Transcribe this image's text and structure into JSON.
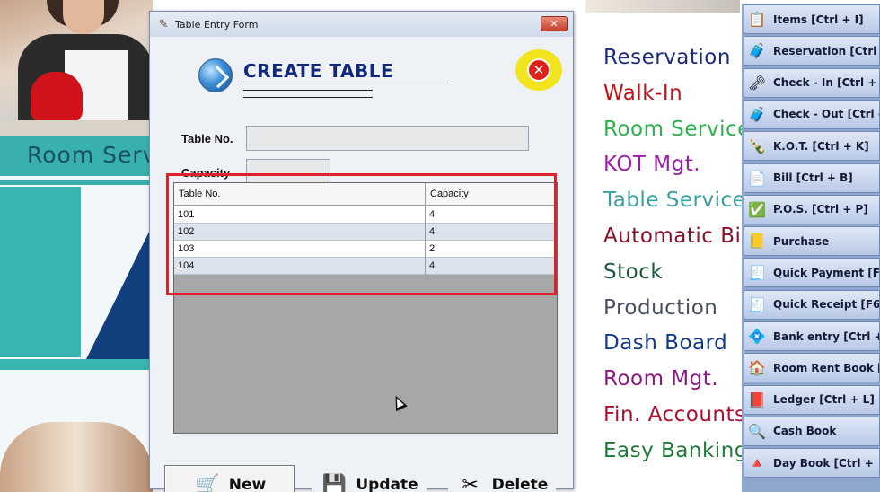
{
  "background": {
    "banner_text": "Room Serv",
    "menu": [
      {
        "label": "Reservation",
        "color": "#1b2a7a"
      },
      {
        "label": "Walk-In",
        "color": "#c0131b"
      },
      {
        "label": "Room Service",
        "color": "#2bb24c"
      },
      {
        "label": "KOT Mgt.",
        "color": "#9b1fa6"
      },
      {
        "label": "Table Service",
        "color": "#3aa1a0"
      },
      {
        "label": "Automatic Bil",
        "color": "#8a0f2a"
      },
      {
        "label": "Stock",
        "color": "#1d5a3a"
      },
      {
        "label": "Production",
        "color": "#4b4f63"
      },
      {
        "label": "Dash Board",
        "color": "#133b8c"
      },
      {
        "label": "Room Mgt.",
        "color": "#8b1a7e"
      },
      {
        "label": "Fin. Accounts",
        "color": "#b0102f"
      },
      {
        "label": "Easy Banking",
        "color": "#1f7a3a"
      }
    ]
  },
  "sidebar": {
    "buttons": [
      {
        "label": "Items [Ctrl + I]",
        "icon": "items-icon",
        "glyph": "📋"
      },
      {
        "label": "Reservation [Ctrl",
        "icon": "reservation-icon",
        "glyph": "🧳"
      },
      {
        "label": "Check - In [Ctrl +",
        "icon": "check-in-icon",
        "glyph": "🗝"
      },
      {
        "label": "Check - Out [Ctrl -",
        "icon": "check-out-icon",
        "glyph": "🧳"
      },
      {
        "label": "K.O.T. [Ctrl + K]",
        "icon": "kot-icon",
        "glyph": "🍾"
      },
      {
        "label": "Bill [Ctrl + B]",
        "icon": "bill-icon",
        "glyph": "📄"
      },
      {
        "label": "P.O.S. [Ctrl + P]",
        "icon": "pos-icon",
        "glyph": "✅"
      },
      {
        "label": "Purchase",
        "icon": "purchase-icon",
        "glyph": "📒"
      },
      {
        "label": "Quick Payment [F5",
        "icon": "quick-payment-icon",
        "glyph": "🧾"
      },
      {
        "label": "Quick Receipt [F6]",
        "icon": "quick-receipt-icon",
        "glyph": "🧾"
      },
      {
        "label": "Bank entry [Ctrl +",
        "icon": "bank-entry-icon",
        "glyph": "💠"
      },
      {
        "label": "Room Rent Book [",
        "icon": "room-rent-icon",
        "glyph": "🏠"
      },
      {
        "label": "Ledger [Ctrl + L]",
        "icon": "ledger-icon",
        "glyph": "📕"
      },
      {
        "label": "Cash Book",
        "icon": "cash-book-icon",
        "glyph": "🔍"
      },
      {
        "label": "Day Book [Ctrl +",
        "icon": "day-book-icon",
        "glyph": "🔺"
      }
    ]
  },
  "dialog": {
    "title": "Table Entry Form",
    "title_close": "✕",
    "header": "CREATE TABLE",
    "close_glyph": "✕",
    "fields": {
      "table_no": {
        "label": "Table No.",
        "value": ""
      },
      "capacity": {
        "label": "Capacity",
        "value": ""
      }
    },
    "grid": {
      "columns": [
        "Table No.",
        "Capacity"
      ],
      "rows": [
        [
          "101",
          "4"
        ],
        [
          "102",
          "4"
        ],
        [
          "103",
          "2"
        ],
        [
          "104",
          "4"
        ]
      ]
    },
    "buttons": {
      "new": "New",
      "update": "Update",
      "delete": "Delete"
    }
  }
}
